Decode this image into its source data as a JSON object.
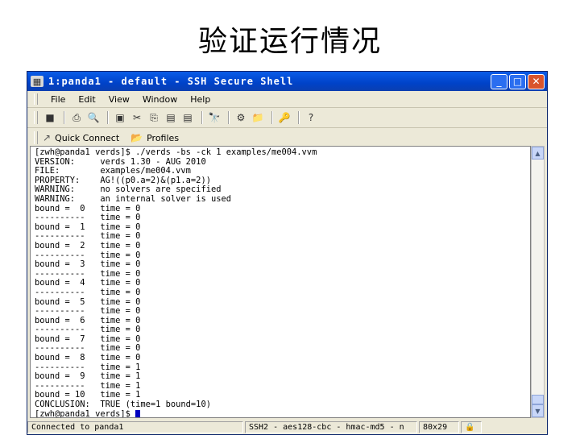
{
  "slide": {
    "title": "验证运行情况"
  },
  "window": {
    "title": "1:panda1 - default - SSH Secure Shell",
    "minimize_glyph": "_",
    "maximize_glyph": "□",
    "close_glyph": "✕"
  },
  "menu": {
    "items": [
      "File",
      "Edit",
      "View",
      "Window",
      "Help"
    ]
  },
  "toolbar": {
    "icons": [
      "save-icon",
      "print-icon",
      "print-preview-icon",
      "copy-icon",
      "cut-icon",
      "paste-icon",
      "clipboard-icon",
      "clipboard-icon",
      "find-icon",
      "settings-icon",
      "new-connection-icon",
      "key-icon",
      "help-icon"
    ],
    "glyphs": [
      "■",
      "⎙",
      "🔍",
      "▣",
      "✂",
      "⎘",
      "▤",
      "▤",
      "🔭",
      "⚙",
      "📁",
      "🔑",
      "?"
    ]
  },
  "quickbar": {
    "quick_connect": "Quick Connect",
    "profiles": "Profiles",
    "quick_connect_glyph": "↗",
    "profiles_glyph": "📂"
  },
  "terminal": {
    "lines": [
      "[zwh@panda1 verds]$ ./verds -bs -ck 1 examples/me004.vvm",
      "VERSION:     verds 1.30 - AUG 2010",
      "FILE:        examples/me004.vvm",
      "PROPERTY:    AG!((p0.a=2)&(p1.a=2))",
      "WARNING:     no solvers are specified",
      "WARNING:     an internal solver is used",
      "bound =  0   time = 0",
      "----------   time = 0",
      "bound =  1   time = 0",
      "----------   time = 0",
      "bound =  2   time = 0",
      "----------   time = 0",
      "bound =  3   time = 0",
      "----------   time = 0",
      "bound =  4   time = 0",
      "----------   time = 0",
      "bound =  5   time = 0",
      "----------   time = 0",
      "bound =  6   time = 0",
      "----------   time = 0",
      "bound =  7   time = 0",
      "----------   time = 0",
      "bound =  8   time = 0",
      "----------   time = 1",
      "bound =  9   time = 1",
      "----------   time = 1",
      "bound = 10   time = 1",
      "CONCLUSION:  TRUE (time=1 bound=10)"
    ],
    "prompt": "[zwh@panda1 verds]$ "
  },
  "scrollbar": {
    "up_glyph": "▲",
    "down_glyph": "▼"
  },
  "status": {
    "connection": "Connected to panda1",
    "cipher": "SSH2 - aes128-cbc - hmac-md5 - n",
    "size": "80x29",
    "lock_glyph": "🔒"
  }
}
